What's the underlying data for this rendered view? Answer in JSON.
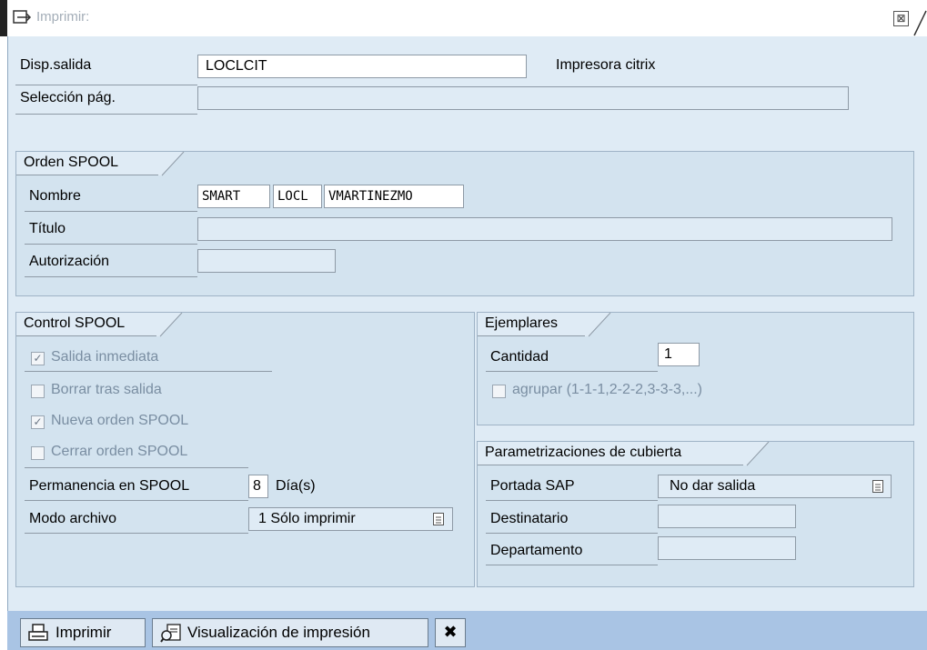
{
  "window": {
    "title": "Imprimir:",
    "close_glyph": "⊠"
  },
  "output": {
    "device_label": "Disp.salida",
    "device_value": "LOCLCIT",
    "device_description": "Impresora citrix",
    "page_selection_label": "Selección pág.",
    "page_selection_value": ""
  },
  "spool_order": {
    "title": "Orden SPOOL",
    "name_label": "Nombre",
    "name_parts": [
      "SMART",
      "LOCL",
      "VMARTINEZMO"
    ],
    "title_label": "Título",
    "title_value": "",
    "authorization_label": "Autorización",
    "authorization_value": ""
  },
  "spool_control": {
    "title": "Control SPOOL",
    "checkboxes": [
      {
        "label": "Salida inmediata",
        "checked": true
      },
      {
        "label": "Borrar tras salida",
        "checked": false
      },
      {
        "label": "Nueva orden SPOOL",
        "checked": true
      },
      {
        "label": "Cerrar orden SPOOL",
        "checked": false
      }
    ],
    "retention_label": "Permanencia en SPOOL",
    "retention_value": "8",
    "retention_unit": "Día(s)",
    "archive_mode_label": "Modo archivo",
    "archive_mode_value": "1 Sólo imprimir"
  },
  "copies": {
    "title": "Ejemplares",
    "quantity_label": "Cantidad",
    "quantity_value": "1",
    "group_label": "agrupar (1-1-1,2-2-2,3-3-3,...)",
    "group_checked": false
  },
  "cover_settings": {
    "title": "Parametrizaciones de cubierta",
    "sap_cover_label": "Portada SAP",
    "sap_cover_value": "No dar salida",
    "recipient_label": "Destinatario",
    "recipient_value": "",
    "department_label": "Departamento",
    "department_value": ""
  },
  "toolbar": {
    "print_label": "Imprimir",
    "preview_label": "Visualización de impresión",
    "cancel_glyph": "✖"
  },
  "icons": {
    "title": "window-print-icon",
    "print": "printer-icon",
    "preview": "print-preview-icon",
    "cancel": "cancel-icon",
    "dropdown": "dropdown-list-icon"
  },
  "colors": {
    "panel": "#dfebf5",
    "group": "#d3e3ef",
    "toolbar": "#a9c4e4",
    "disabled_text": "#7a8ea2"
  }
}
